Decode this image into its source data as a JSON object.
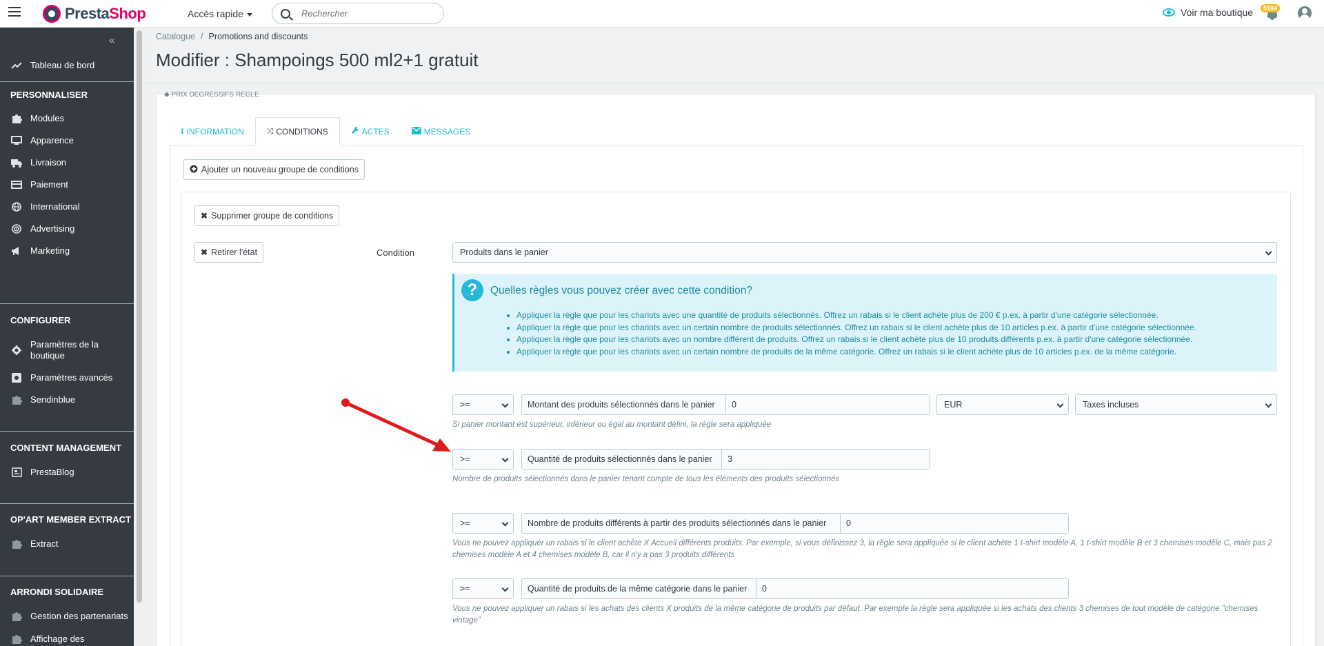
{
  "header": {
    "logo_part1": "Presta",
    "logo_part2": "Shop",
    "quick_access": "Accès rapide",
    "search_placeholder": "Rechercher",
    "view_shop": "Voir ma boutique",
    "notification_count": "5184"
  },
  "sidebar": {
    "collapse_label": "«",
    "dashboard": "Tableau de bord",
    "sections": [
      {
        "title": "PERSONNALISER",
        "items": [
          "Modules",
          "Apparence",
          "Livraison",
          "Paiement",
          "International",
          "Advertising",
          "Marketing"
        ]
      },
      {
        "title": "CONFIGURER",
        "items": [
          "Paramètres de la boutique",
          "Paramètres avancés",
          "Sendinblue"
        ]
      },
      {
        "title": "CONTENT MANAGEMENT",
        "items": [
          "PrestaBlog"
        ]
      },
      {
        "title": "OP'ART MEMBER EXTRACT",
        "items": [
          "Extract"
        ]
      },
      {
        "title": "ARRONDI SOLIDAIRE",
        "items": [
          "Gestion des partenariats",
          "Affichage des"
        ]
      }
    ]
  },
  "breadcrumb": {
    "parent": "Catalogue",
    "current": "Promotions and discounts"
  },
  "page_title": "Modifier : Shampoings 500 ml2+1 gratuit",
  "cut_heading": "PRIX DÉGRESSIFS RÈGLE",
  "tabs": [
    {
      "label": "INFORMATION",
      "icon": "info-icon",
      "active": false
    },
    {
      "label": "CONDITIONS",
      "icon": "random-icon",
      "active": true
    },
    {
      "label": "ACTES",
      "icon": "wrench-icon",
      "active": false
    },
    {
      "label": "MESSAGES",
      "icon": "envelope-icon",
      "active": false
    }
  ],
  "buttons": {
    "add_group": "Ajouter un nouveau groupe de conditions",
    "delete_group": "Supprimer groupe de conditions",
    "remove_state": "Retirer l'état"
  },
  "condition": {
    "label": "Condition",
    "selected": "Produits dans le panier"
  },
  "info_box": {
    "title": "Quelles règles vous pouvez créer avec cette condition?",
    "items": [
      "Appliquer la règle que pour les chariots avec une quantité de produits sélectionnés. Offrez un rabais si le client achète plus de 200 € p.ex. à partir d'une catégorie sélectionnée.",
      "Appliquer la règle que pour les chariots avec un certain nombre de produits sélectionnés. Offrez un rabais si le client achète plus de 10 articles p.ex. à partir d'une catégorie sélectionnée.",
      "Appliquer la règle que pour les chariots avec un nombre différent de produits. Offrez un rabais si le client achète plus de 10 produits différents p.ex. à partir d'une catégorie sélectionnée.",
      "Appliquer la règle que pour les chariots avec un certain nombre de produits de la même catégorie. Offrez un rabais si le client achète plus de 10 articles p.ex. de la même catégorie."
    ]
  },
  "fields": {
    "amount": {
      "operator": ">=",
      "label": "Montant des produits sélectionnés dans le panier",
      "value": "0",
      "currency": "EUR",
      "tax": "Taxes incluses",
      "help": "Si panier montant est supérieur, inférieur ou égal au montant défini, la règle sera appliquée"
    },
    "quantity": {
      "operator": ">=",
      "label": "Quantité de produits sélectionnés dans le panier",
      "value": "3",
      "help": "Nombre de produits sélectionnés dans le panier tenant compte de tous les éléments des produits sélectionnés"
    },
    "different": {
      "operator": ">=",
      "label": "Nombre de produits différents à partir des produits sélectionnés dans le panier",
      "value": "0",
      "help": "Vous ne pouvez appliquer un rabais si le client achète X Accueil différents produits. Par exemple, si vous définissez 3, la règle sera appliquée si le client achète 1 t-shirt modèle A, 1 t-shirt modèle B et 3 chemises modèle C, mais pas 2 chemises modèle A et 4 chemises modèle B, car il n'y a pas 3 produits différents"
    },
    "same_category": {
      "operator": ">=",
      "label": "Quantité de produits de la même catégorie dans le panier",
      "value": "0",
      "help": "Vous ne pouvez appliquer un rabais si les achats des clients X produits de la même catégorie de produits par défaut. Par exemple la règle sera appliquée si les achats des clients 3 chemises de tout modèle de catégorie \"chemises vintage\""
    }
  },
  "colors": {
    "accent": "#25b9d7",
    "brand": "#df0067",
    "sidebar": "#363a41",
    "arrow": "#e01b1b"
  }
}
